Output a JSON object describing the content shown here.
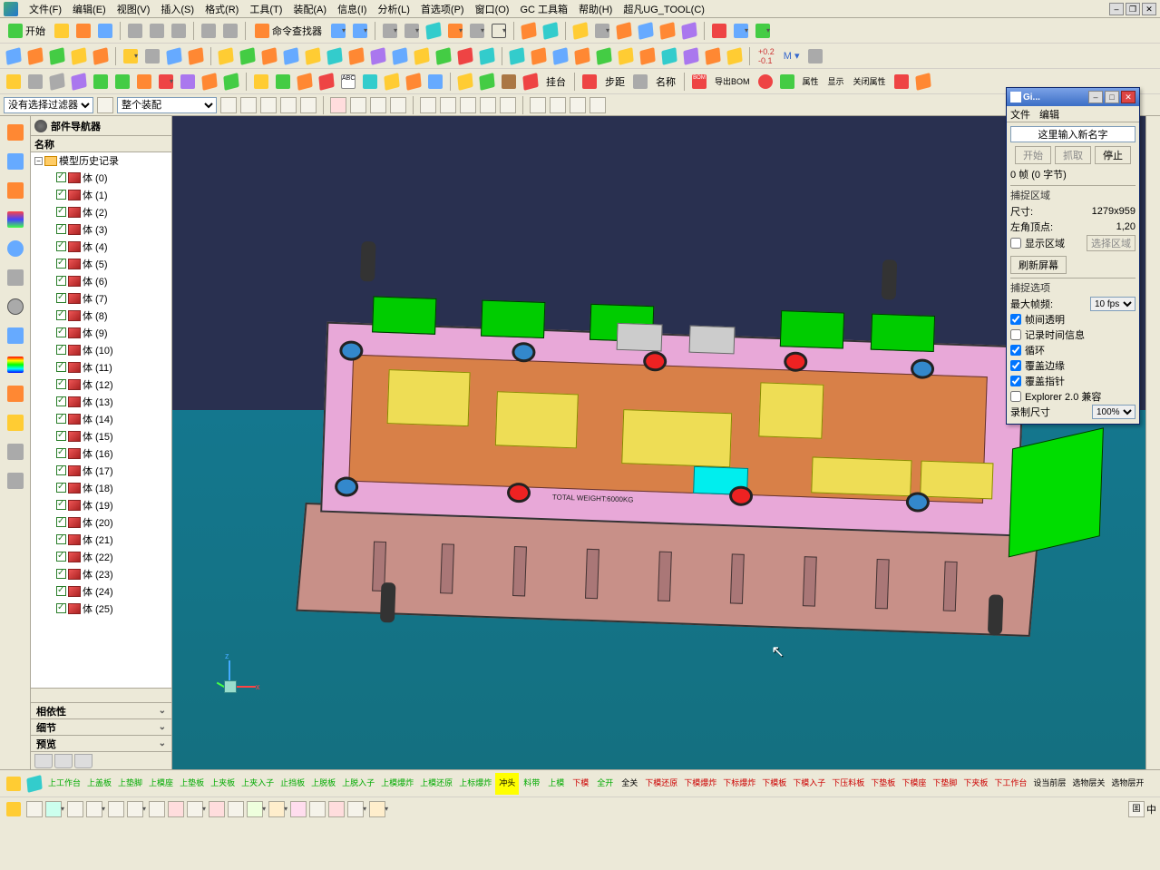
{
  "menubar": {
    "items": [
      "文件(F)",
      "编辑(E)",
      "视图(V)",
      "插入(S)",
      "格式(R)",
      "工具(T)",
      "装配(A)",
      "信息(I)",
      "分析(L)",
      "首选项(P)",
      "窗口(O)",
      "GC 工具箱",
      "帮助(H)",
      "超凡UG_TOOL(C)"
    ]
  },
  "toolbar1": {
    "start_label": "开始",
    "cmd_finder_label": "命令查找器"
  },
  "filter": {
    "no_selection_filter": "没有选择过滤器",
    "entire_assembly": "整个装配"
  },
  "navigator": {
    "title": "部件导航器",
    "header": "名称",
    "root": "模型历史记录",
    "items": [
      {
        "label": "体 (0)"
      },
      {
        "label": "体 (1)"
      },
      {
        "label": "体 (2)"
      },
      {
        "label": "体 (3)"
      },
      {
        "label": "体 (4)"
      },
      {
        "label": "体 (5)"
      },
      {
        "label": "体 (6)"
      },
      {
        "label": "体 (7)"
      },
      {
        "label": "体 (8)"
      },
      {
        "label": "体 (9)"
      },
      {
        "label": "体 (10)"
      },
      {
        "label": "体 (11)"
      },
      {
        "label": "体 (12)"
      },
      {
        "label": "体 (13)"
      },
      {
        "label": "体 (14)"
      },
      {
        "label": "体 (15)"
      },
      {
        "label": "体 (16)"
      },
      {
        "label": "体 (17)"
      },
      {
        "label": "体 (18)"
      },
      {
        "label": "体 (19)"
      },
      {
        "label": "体 (20)"
      },
      {
        "label": "体 (21)"
      },
      {
        "label": "体 (22)"
      },
      {
        "label": "体 (23)"
      },
      {
        "label": "体 (24)"
      },
      {
        "label": "体 (25)"
      }
    ],
    "sections": [
      "相依性",
      "细节",
      "预览"
    ]
  },
  "viewport": {
    "engraving": "TOTAL WEIGHT:6000KG",
    "axis_x": "x",
    "axis_z": "z"
  },
  "bottom_toolbar": {
    "items": [
      {
        "label": "上工作台",
        "cls": "bb-g"
      },
      {
        "label": "上盖板",
        "cls": "bb-g"
      },
      {
        "label": "上垫脚",
        "cls": "bb-g"
      },
      {
        "label": "上模座",
        "cls": "bb-g"
      },
      {
        "label": "上垫板",
        "cls": "bb-g"
      },
      {
        "label": "上夹板",
        "cls": "bb-g"
      },
      {
        "label": "上夹入子",
        "cls": "bb-g"
      },
      {
        "label": "止挡板",
        "cls": "bb-g"
      },
      {
        "label": "上脱板",
        "cls": "bb-g"
      },
      {
        "label": "上脱入子",
        "cls": "bb-g"
      },
      {
        "label": "上模爆炸",
        "cls": "bb-g"
      },
      {
        "label": "上模还原",
        "cls": "bb-g"
      },
      {
        "label": "上标爆炸",
        "cls": "bb-g"
      },
      {
        "label": "冲头",
        "cls": "bb-y"
      },
      {
        "label": "料带",
        "cls": "bb-g"
      },
      {
        "label": "上模",
        "cls": "bb-g"
      },
      {
        "label": "下模",
        "cls": "bb-r"
      },
      {
        "label": "全开",
        "cls": "bb-g"
      },
      {
        "label": "全关",
        "cls": ""
      },
      {
        "label": "下模还原",
        "cls": "bb-r"
      },
      {
        "label": "下模爆炸",
        "cls": "bb-r"
      },
      {
        "label": "下标爆炸",
        "cls": "bb-r"
      },
      {
        "label": "下模板",
        "cls": "bb-r"
      },
      {
        "label": "下模入子",
        "cls": "bb-r"
      },
      {
        "label": "下压料板",
        "cls": "bb-r"
      },
      {
        "label": "下垫板",
        "cls": "bb-r"
      },
      {
        "label": "下模座",
        "cls": "bb-r"
      },
      {
        "label": "下垫脚",
        "cls": "bb-r"
      },
      {
        "label": "下夹板",
        "cls": "bb-r"
      },
      {
        "label": "下工作台",
        "cls": "bb-r"
      },
      {
        "label": "设当前层",
        "cls": ""
      },
      {
        "label": "选物层关",
        "cls": ""
      },
      {
        "label": "选物层开",
        "cls": ""
      }
    ]
  },
  "bottom_toolbar_extra": {
    "labels": {
      "hang": "挂台",
      "step": "步距",
      "name": "名称",
      "export": "导出BOM",
      "attr": "属性",
      "close_attr": "关闭属性",
      "show": "显示"
    }
  },
  "dialog": {
    "title": "Gi...",
    "menu": [
      "文件",
      "编辑"
    ],
    "name_placeholder": "这里输入新名字",
    "btn_start": "开始",
    "btn_grab": "抓取",
    "btn_stop": "停止",
    "status": "0 帧 (0 字节)",
    "group1_title": "捕捉区域",
    "size_label": "尺寸:",
    "size_value": "1279x959",
    "origin_label": "左角顶点:",
    "origin_value": "1,20",
    "show_region": "显示区域",
    "select_region": "选择区域",
    "refresh": "刷新屏幕",
    "group2_title": "捕捉选项",
    "max_fps_label": "最大帧频:",
    "max_fps_value": "10 fps",
    "opt_transparent": "帧间透明",
    "opt_timestamp": "记录时间信息",
    "opt_loop": "循环",
    "opt_edge": "覆盖边缘",
    "opt_pointer": "覆盖指针",
    "opt_explorer": "Explorer 2.0 兼容",
    "rec_size_label": "录制尺寸",
    "rec_size_value": "100%"
  },
  "status_extra": {
    "lang": "中"
  }
}
